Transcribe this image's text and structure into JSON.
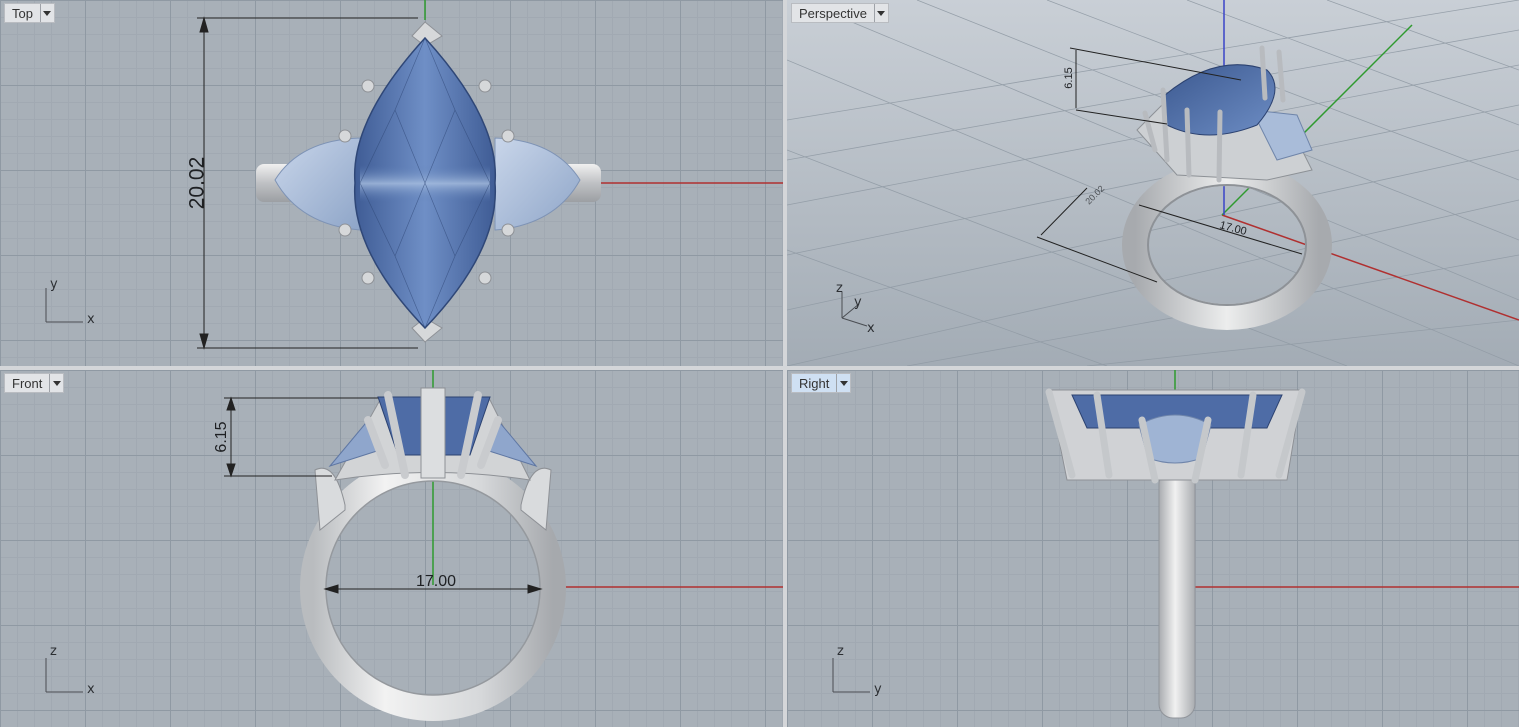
{
  "viewports": {
    "top": {
      "label": "Top",
      "axis_h": "x",
      "axis_v": "y",
      "dimension": "20.02"
    },
    "perspective": {
      "label": "Perspective",
      "axis_x": "x",
      "axis_y": "y",
      "axis_z": "z",
      "dim_height": "6.15",
      "dim_width": "17.00",
      "dim_length": "20.02"
    },
    "front": {
      "label": "Front",
      "axis_h": "x",
      "axis_v": "z",
      "dim_height": "6.15",
      "dim_width": "17.00"
    },
    "right": {
      "label": "Right",
      "axis_h": "y",
      "axis_v": "z",
      "active": true
    }
  },
  "colors": {
    "viewport_bg": "#a8b0b8",
    "grid_major": "#8f99a3",
    "grid_minor": "#a1a9b2",
    "x_axis": "#b03030",
    "y_axis": "#2f9a2f",
    "z_axis": "#3a44c8",
    "gem_blue": "#4e6ca6",
    "side_stone": "#9fb4d4",
    "metal": "#d2d4d6",
    "active_tab": "#cfe0f3"
  }
}
